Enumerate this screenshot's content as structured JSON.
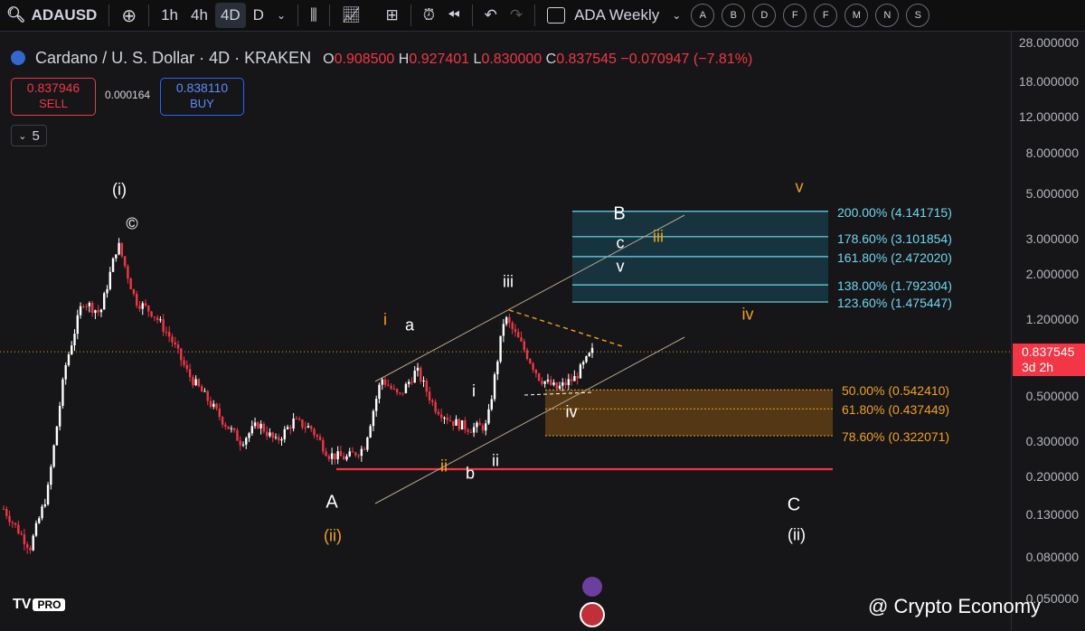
{
  "toolbar": {
    "symbol": "ADAUSD",
    "intervals": [
      "1h",
      "4h",
      "4D",
      "D"
    ],
    "active_interval": "4D",
    "layout_name": "ADA Weekly",
    "letter_buttons": [
      "A",
      "B",
      "D",
      "F",
      "F",
      "M",
      "N",
      "S"
    ]
  },
  "legend": {
    "title": "Cardano / U. S. Dollar · 4D · KRAKEN",
    "o_label": "O",
    "o": "0.908500",
    "h_label": "H",
    "h": "0.927401",
    "l_label": "L",
    "l": "0.830000",
    "c_label": "C",
    "c": "0.837545",
    "change": "−0.070947 (−7.81%)"
  },
  "trade": {
    "sell_price": "0.837946",
    "sell_label": "SELL",
    "spread": "0.000164",
    "buy_price": "0.838110",
    "buy_label": "BUY"
  },
  "indicators_collapsed": "5",
  "current_price": {
    "price": "0.837545",
    "countdown": "3d 2h"
  },
  "colors": {
    "up": "#ffffff",
    "down": "#f23645",
    "fib_blue": "#6fd6f0",
    "fib_orange": "#f0a020",
    "support": "#f23645"
  },
  "watermark": "@ Crypto Economy",
  "logo_text": "TV",
  "logo_badge": "PRO",
  "chart_data": {
    "type": "candlestick",
    "scale": "log",
    "y_ticks": [
      "28.000000",
      "18.000000",
      "12.000000",
      "8.000000",
      "5.000000",
      "3.000000",
      "2.000000",
      "1.200000",
      "0.500000",
      "0.300000",
      "0.200000",
      "0.130000",
      "0.080000",
      "0.050000"
    ],
    "price_path": [
      {
        "t": 0,
        "p": 0.14
      },
      {
        "t": 3,
        "p": 0.09
      },
      {
        "t": 5,
        "p": 0.17
      },
      {
        "t": 7,
        "p": 0.7
      },
      {
        "t": 9,
        "p": 1.5
      },
      {
        "t": 11,
        "p": 1.3
      },
      {
        "t": 13,
        "p": 2.9
      },
      {
        "t": 15,
        "p": 1.5
      },
      {
        "t": 17,
        "p": 1.3
      },
      {
        "t": 19,
        "p": 0.98
      },
      {
        "t": 21,
        "p": 0.65
      },
      {
        "t": 23,
        "p": 0.5
      },
      {
        "t": 25,
        "p": 0.38
      },
      {
        "t": 27,
        "p": 0.3
      },
      {
        "t": 29,
        "p": 0.37
      },
      {
        "t": 31,
        "p": 0.3
      },
      {
        "t": 33,
        "p": 0.38
      },
      {
        "t": 35,
        "p": 0.35
      },
      {
        "t": 37,
        "p": 0.26
      },
      {
        "t": 39,
        "p": 0.25
      },
      {
        "t": 41,
        "p": 0.28
      },
      {
        "t": 43,
        "p": 0.62
      },
      {
        "t": 45,
        "p": 0.5
      },
      {
        "t": 47,
        "p": 0.68
      },
      {
        "t": 49,
        "p": 0.45
      },
      {
        "t": 51,
        "p": 0.38
      },
      {
        "t": 53,
        "p": 0.35
      },
      {
        "t": 55,
        "p": 0.36
      },
      {
        "t": 57,
        "p": 1.25
      },
      {
        "t": 59,
        "p": 0.9
      },
      {
        "t": 61,
        "p": 0.62
      },
      {
        "t": 63,
        "p": 0.55
      },
      {
        "t": 65,
        "p": 0.62
      },
      {
        "t": 67,
        "p": 0.84
      }
    ],
    "support_level": 0.22,
    "fib_extensions": [
      {
        "label": "200.00% (4.141715)",
        "price": 4.141715
      },
      {
        "label": "178.60% (3.101854)",
        "price": 3.101854
      },
      {
        "label": "161.80% (2.472020)",
        "price": 2.47202
      },
      {
        "label": "138.00% (1.792304)",
        "price": 1.792304
      },
      {
        "label": "123.60% (1.475447)",
        "price": 1.475447
      }
    ],
    "fib_retracements": [
      {
        "label": "50.00% (0.542410)",
        "price": 0.54241
      },
      {
        "label": "61.80% (0.437449)",
        "price": 0.437449
      },
      {
        "label": "78.60% (0.322071)",
        "price": 0.322071
      }
    ],
    "wave_labels_white": [
      "(i)",
      "©",
      "A",
      "a",
      "b",
      "i",
      "ii",
      "iii",
      "iv",
      "B",
      "c",
      "v",
      "C",
      "(ii)"
    ],
    "wave_labels_orange": [
      "i",
      "ii",
      "iii",
      "iv",
      "v",
      "(ii)"
    ]
  }
}
